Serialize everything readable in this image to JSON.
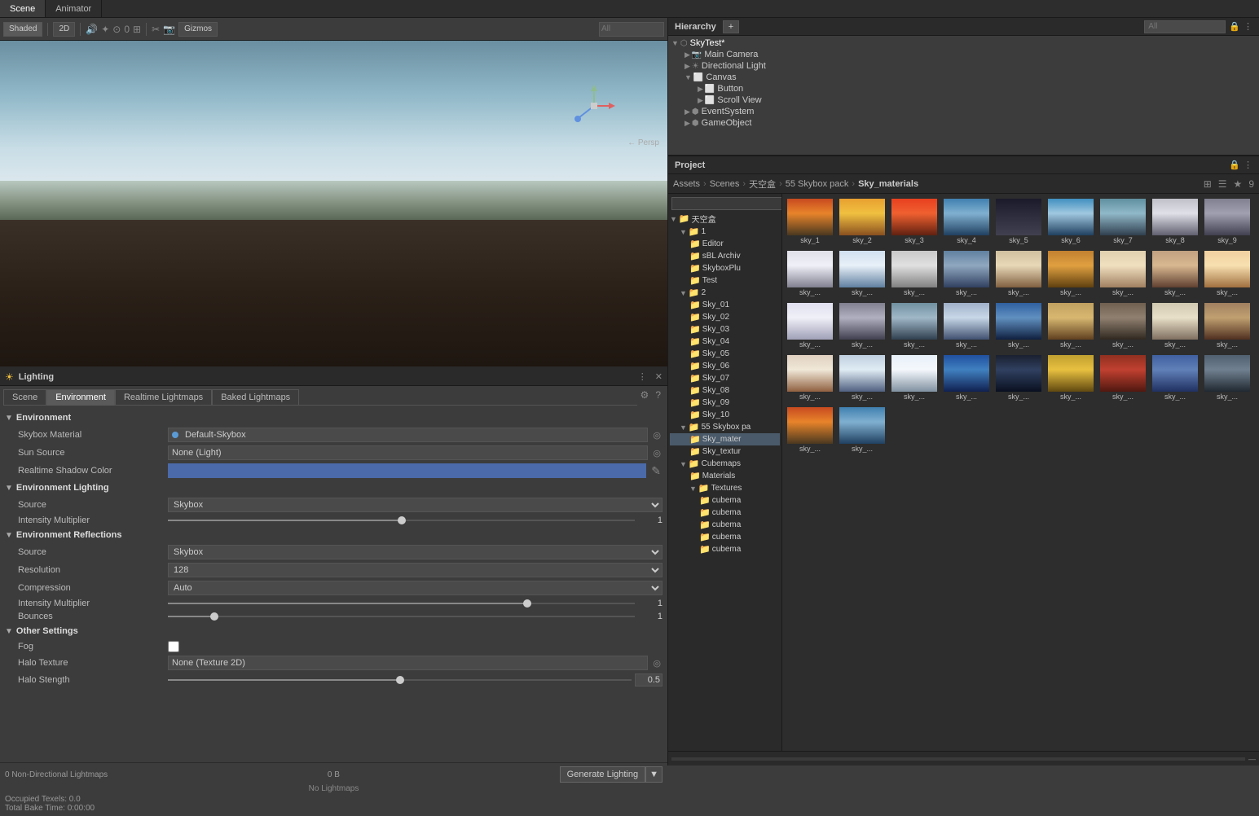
{
  "tabs": {
    "scene_tab": "Scene",
    "animator_tab": "Animator"
  },
  "scene_toolbar": {
    "shaded": "Shaded",
    "2d": "2D",
    "gizmos": "Gizmos",
    "all_filter": "All"
  },
  "scene_gizmo": "← Persp",
  "hierarchy": {
    "title": "Hierarchy",
    "search_placeholder": "All",
    "add_btn": "+",
    "items": [
      {
        "label": "SkyTest*",
        "level": 0,
        "expanded": true,
        "icon": "scene"
      },
      {
        "label": "Main Camera",
        "level": 1,
        "expanded": false,
        "icon": "camera"
      },
      {
        "label": "Directional Light",
        "level": 1,
        "expanded": false,
        "icon": "light"
      },
      {
        "label": "Canvas",
        "level": 1,
        "expanded": true,
        "icon": "canvas"
      },
      {
        "label": "Button",
        "level": 2,
        "expanded": false,
        "icon": "button"
      },
      {
        "label": "Scroll View",
        "level": 2,
        "expanded": false,
        "icon": "scroll"
      },
      {
        "label": "EventSystem",
        "level": 1,
        "expanded": false,
        "icon": "event"
      },
      {
        "label": "GameObject",
        "level": 1,
        "expanded": false,
        "icon": "obj"
      }
    ]
  },
  "lighting": {
    "title": "Lighting",
    "tabs": [
      "Scene",
      "Environment",
      "Realtime Lightmaps",
      "Baked Lightmaps"
    ],
    "active_tab": "Environment",
    "environment": {
      "section": "Environment",
      "skybox_material_label": "Skybox Material",
      "skybox_material_value": "Default-Skybox",
      "sun_source_label": "Sun Source",
      "sun_source_value": "None (Light)",
      "realtime_shadow_color_label": "Realtime Shadow Color",
      "env_lighting_label": "Environment Lighting",
      "env_lighting_source_label": "Source",
      "env_lighting_source_value": "Skybox",
      "intensity_label": "Intensity Multiplier",
      "intensity_value": "1",
      "env_reflections_label": "Environment Reflections",
      "env_reflections_source_label": "Source",
      "env_reflections_source_value": "Skybox",
      "resolution_label": "Resolution",
      "resolution_value": "128",
      "compression_label": "Compression",
      "compression_value": "Auto",
      "env_refl_intensity_label": "Intensity Multiplier",
      "env_refl_intensity_value": "1",
      "bounces_label": "Bounces",
      "bounces_value": "1",
      "other_settings": "Other Settings",
      "fog_label": "Fog",
      "halo_texture_label": "Halo Texture",
      "halo_texture_value": "None (Texture 2D)",
      "halo_strength_label": "Halo Stength",
      "halo_strength_value": "0.5"
    },
    "bottom": {
      "lightmaps_label": "0 Non-Directional Lightmaps",
      "size_value": "0 B",
      "no_lightmaps": "No Lightmaps",
      "generate_btn": "Generate Lighting"
    }
  },
  "project": {
    "title": "Project",
    "search_placeholder": "",
    "breadcrumb": [
      "Assets",
      "Scenes",
      "天空盒",
      "55 Skybox pack",
      "Sky_materials"
    ],
    "tree_items": [
      {
        "label": "天空盒",
        "level": 0,
        "expanded": true,
        "icon": "folder"
      },
      {
        "label": "1",
        "level": 1,
        "expanded": true,
        "icon": "folder"
      },
      {
        "label": "Editor",
        "level": 2,
        "expanded": false,
        "icon": "folder"
      },
      {
        "label": "sBL Archiv",
        "level": 2,
        "expanded": false,
        "icon": "folder"
      },
      {
        "label": "SkyboxPlu",
        "level": 2,
        "expanded": false,
        "icon": "folder"
      },
      {
        "label": "Test",
        "level": 2,
        "expanded": false,
        "icon": "folder"
      },
      {
        "label": "2",
        "level": 1,
        "expanded": true,
        "icon": "folder"
      },
      {
        "label": "Sky_01",
        "level": 2,
        "expanded": false,
        "icon": "folder"
      },
      {
        "label": "Sky_02",
        "level": 2,
        "expanded": false,
        "icon": "folder"
      },
      {
        "label": "Sky_03",
        "level": 2,
        "expanded": false,
        "icon": "folder"
      },
      {
        "label": "Sky_04",
        "level": 2,
        "expanded": false,
        "icon": "folder"
      },
      {
        "label": "Sky_05",
        "level": 2,
        "expanded": false,
        "icon": "folder"
      },
      {
        "label": "Sky_06",
        "level": 2,
        "expanded": false,
        "icon": "folder"
      },
      {
        "label": "Sky_07",
        "level": 2,
        "expanded": false,
        "icon": "folder"
      },
      {
        "label": "Sky_08",
        "level": 2,
        "expanded": false,
        "icon": "folder"
      },
      {
        "label": "Sky_09",
        "level": 2,
        "expanded": false,
        "icon": "folder"
      },
      {
        "label": "Sky_10",
        "level": 2,
        "expanded": false,
        "icon": "folder"
      },
      {
        "label": "55 Skybox pa",
        "level": 1,
        "expanded": true,
        "icon": "folder"
      },
      {
        "label": "Sky_mater",
        "level": 2,
        "expanded": false,
        "icon": "folder"
      },
      {
        "label": "Sky_textur",
        "level": 2,
        "expanded": false,
        "icon": "folder"
      },
      {
        "label": "Cubemaps",
        "level": 1,
        "expanded": true,
        "icon": "folder"
      },
      {
        "label": "Materials",
        "level": 2,
        "expanded": false,
        "icon": "folder"
      },
      {
        "label": "Textures",
        "level": 2,
        "expanded": true,
        "icon": "folder"
      },
      {
        "label": "cubema",
        "level": 3,
        "expanded": false,
        "icon": "folder"
      },
      {
        "label": "cubema",
        "level": 3,
        "expanded": false,
        "icon": "folder"
      },
      {
        "label": "cubema",
        "level": 3,
        "expanded": false,
        "icon": "folder"
      },
      {
        "label": "cubema",
        "level": 3,
        "expanded": false,
        "icon": "folder"
      },
      {
        "label": "cubema",
        "level": 3,
        "expanded": false,
        "icon": "folder"
      }
    ],
    "assets": [
      {
        "name": "sky_1",
        "style": "sky-t1"
      },
      {
        "name": "sky_2",
        "style": "sky-t2"
      },
      {
        "name": "sky_3",
        "style": "sky-t3"
      },
      {
        "name": "sky_4",
        "style": "sky-t4"
      },
      {
        "name": "sky_5",
        "style": "sky-t5"
      },
      {
        "name": "sky_6",
        "style": "sky-t6"
      },
      {
        "name": "sky_7",
        "style": "sky-t7"
      },
      {
        "name": "sky_8",
        "style": "sky-t8"
      },
      {
        "name": "sky_9",
        "style": "sky-t9"
      },
      {
        "name": "sky_...",
        "style": "sky-t10"
      },
      {
        "name": "sky_...",
        "style": "sky-t11"
      },
      {
        "name": "sky_...",
        "style": "sky-t12"
      },
      {
        "name": "sky_...",
        "style": "sky-t13"
      },
      {
        "name": "sky_...",
        "style": "sky-t14"
      },
      {
        "name": "sky_...",
        "style": "sky-t15"
      },
      {
        "name": "sky_...",
        "style": "sky-t16"
      },
      {
        "name": "sky_...",
        "style": "sky-t17"
      },
      {
        "name": "sky_...",
        "style": "sky-t18"
      },
      {
        "name": "sky_...",
        "style": "sky-t19"
      },
      {
        "name": "sky_...",
        "style": "sky-t20"
      },
      {
        "name": "sky_...",
        "style": "sky-t21"
      },
      {
        "name": "sky_...",
        "style": "sky-t22"
      },
      {
        "name": "sky_...",
        "style": "sky-t23"
      },
      {
        "name": "sky_...",
        "style": "sky-t24"
      },
      {
        "name": "sky_...",
        "style": "sky-t25"
      },
      {
        "name": "sky_...",
        "style": "sky-t26"
      },
      {
        "name": "sky_...",
        "style": "sky-t27"
      },
      {
        "name": "sky_...",
        "style": "sky-t28"
      },
      {
        "name": "sky_...",
        "style": "sky-t29"
      },
      {
        "name": "sky_...",
        "style": "sky-t30"
      },
      {
        "name": "sky_...",
        "style": "sky-t31"
      },
      {
        "name": "sky_...",
        "style": "sky-t32"
      },
      {
        "name": "sky_...",
        "style": "sky-t33"
      },
      {
        "name": "sky_...",
        "style": "sky-t34"
      },
      {
        "name": "sky_...",
        "style": "sky-t35"
      },
      {
        "name": "sky_...",
        "style": "sky-t36"
      },
      {
        "name": "sky_...",
        "style": "sky-t1"
      },
      {
        "name": "sky_...",
        "style": "sky-t4"
      }
    ]
  }
}
